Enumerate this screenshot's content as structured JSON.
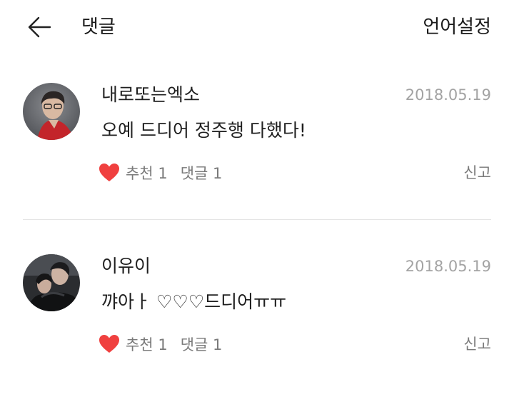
{
  "header": {
    "title": "댓글",
    "language_label": "언어설정"
  },
  "comments": [
    {
      "nickname": "내로또는엑소",
      "date": "2018.05.19",
      "text": "오예 드디어 정주행 다했다!",
      "like_label": "추천 1",
      "reply_label": "댓글 1",
      "report_label": "신고"
    },
    {
      "nickname": "이유이",
      "date": "2018.05.19",
      "text": "꺄아ㅏ ♡♡♡드디어ㅠㅠ",
      "like_label": "추천 1",
      "reply_label": "댓글 1",
      "report_label": "신고"
    }
  ],
  "colors": {
    "heart": "#f0403f",
    "date": "#a3a3a3",
    "meta": "#7a7a7a",
    "divider": "#e4e4e4"
  },
  "icons": {
    "back": "arrow-left-icon",
    "like": "heart-icon"
  }
}
